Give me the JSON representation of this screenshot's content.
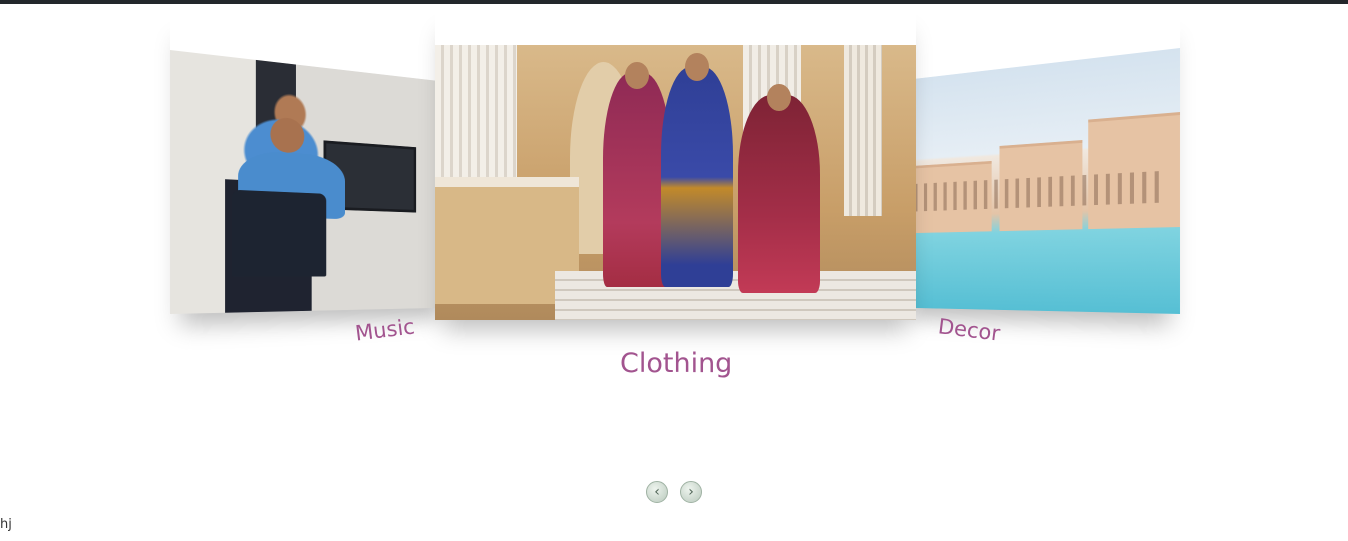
{
  "carousel": {
    "items": [
      {
        "label": "Music",
        "image_icon": "image-music-studio"
      },
      {
        "label": "Clothing",
        "image_icon": "image-clothing-models"
      },
      {
        "label": "Decor",
        "image_icon": "image-decor-resort"
      }
    ],
    "active_index": 1,
    "label_color": "#a2548f",
    "prev_button": {
      "glyph": "‹",
      "icon": "chevron-left-icon"
    },
    "next_button": {
      "glyph": "›",
      "icon": "chevron-right-icon"
    }
  },
  "footer": {
    "text": "hj"
  }
}
